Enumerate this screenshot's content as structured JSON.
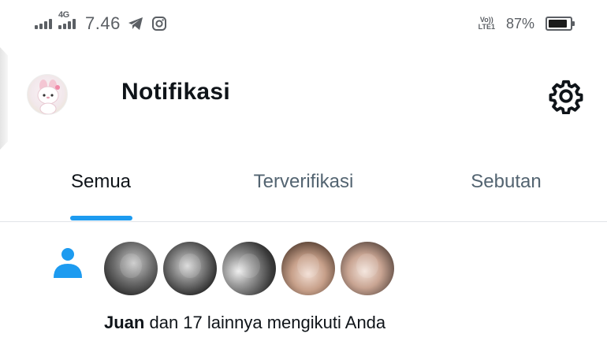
{
  "status_bar": {
    "network_label": "4G",
    "time": "7.46",
    "volte_top": "Vo))",
    "volte_bottom": "LTE1",
    "battery_percent": "87%",
    "battery_level": 0.87,
    "icons": [
      "signal-icon",
      "signal-icon",
      "telegram-icon",
      "instagram-icon",
      "volte-icon",
      "battery-icon"
    ]
  },
  "header": {
    "title": "Notifikasi",
    "avatar_icon": "profile-avatar",
    "settings_icon": "gear-icon"
  },
  "tabs": [
    {
      "label": "Semua",
      "active": true
    },
    {
      "label": "Terverifikasi",
      "active": false
    },
    {
      "label": "Sebutan",
      "active": false
    }
  ],
  "colors": {
    "accent": "#1d9bf0",
    "text_primary": "#0f1419",
    "text_secondary": "#536471"
  },
  "notifications": [
    {
      "type_icon": "person-icon",
      "user": "Juan",
      "text": "dan 17 lainnya mengikuti Anda",
      "avatar_count": 5
    }
  ]
}
